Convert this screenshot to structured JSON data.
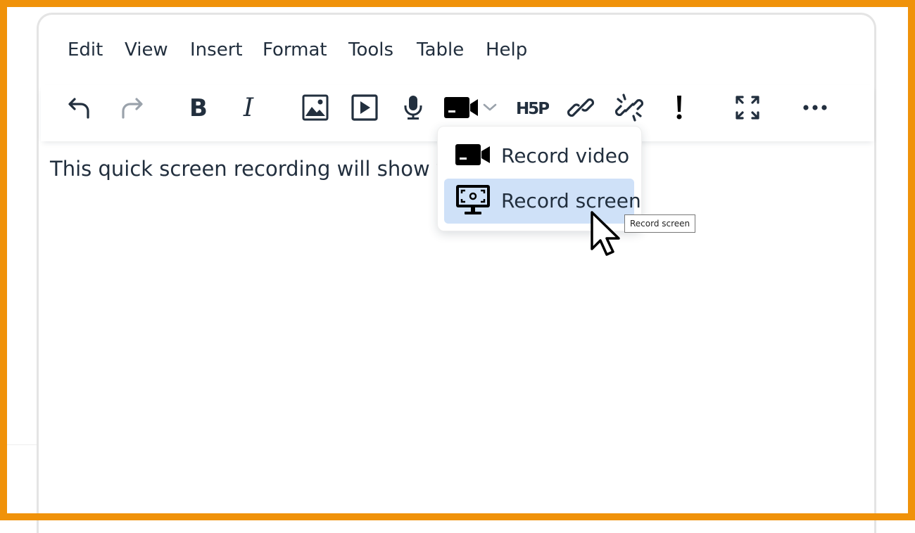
{
  "menubar": {
    "items": [
      {
        "label": "Edit"
      },
      {
        "label": "View"
      },
      {
        "label": "Insert"
      },
      {
        "label": "Format"
      },
      {
        "label": "Tools"
      },
      {
        "label": "Table"
      },
      {
        "label": "Help"
      }
    ]
  },
  "toolbar": {
    "buttons": [
      {
        "icon": "undo-icon"
      },
      {
        "icon": "redo-icon",
        "disabled": true
      },
      {
        "icon": "bold-icon"
      },
      {
        "icon": "italic-icon"
      },
      {
        "icon": "image-icon"
      },
      {
        "icon": "media-icon"
      },
      {
        "icon": "microphone-icon"
      },
      {
        "icon": "video-camera-icon",
        "has_dropdown": true
      },
      {
        "icon": "h5p-icon"
      },
      {
        "icon": "link-icon"
      },
      {
        "icon": "unlink-icon"
      },
      {
        "icon": "exclamation-icon"
      },
      {
        "icon": "fullscreen-icon"
      },
      {
        "icon": "more-icon"
      }
    ]
  },
  "content": {
    "text": "This quick screen recording will show yo"
  },
  "dropdown": {
    "items": [
      {
        "label": "Record video",
        "icon": "video-camera-icon",
        "highlighted": false
      },
      {
        "label": "Record screen",
        "icon": "screen-record-icon",
        "highlighted": true
      }
    ]
  },
  "tooltip": {
    "text": "Record screen"
  },
  "colors": {
    "frame": "#f0920a",
    "text": "#222f3e",
    "highlight": "#cfe1f8",
    "disabled": "#9aa2ab"
  }
}
